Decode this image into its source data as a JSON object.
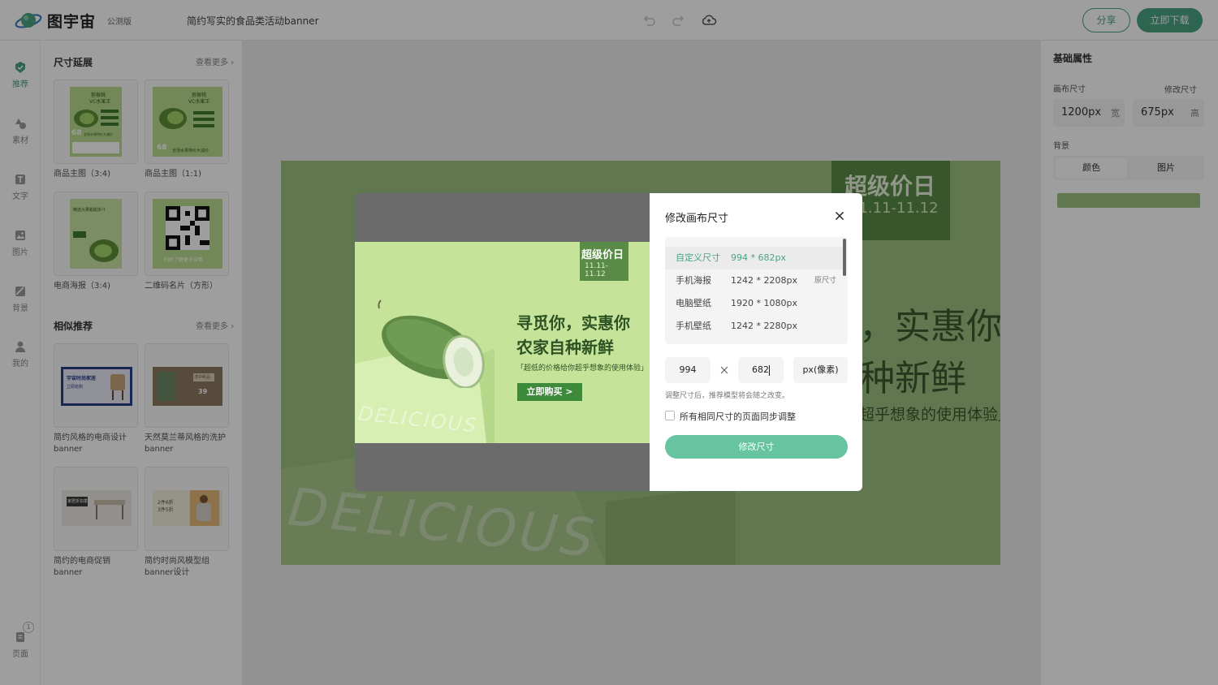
{
  "header": {
    "brand": "图宇宙",
    "beta": "公测版",
    "doc_title": "简约写实的食品类活动banner",
    "share_label": "分享",
    "download_label": "立即下载"
  },
  "rail": {
    "items": [
      {
        "label": "推荐",
        "icon": "recommend-icon"
      },
      {
        "label": "素材",
        "icon": "shapes-icon"
      },
      {
        "label": "文字",
        "icon": "text-icon"
      },
      {
        "label": "图片",
        "icon": "image-icon"
      },
      {
        "label": "背景",
        "icon": "background-icon"
      },
      {
        "label": "我的",
        "icon": "user-icon"
      }
    ],
    "pages_label": "页面",
    "pages_count": "1"
  },
  "left_panel": {
    "size_section": {
      "title": "尺寸延展",
      "more": "查看更多",
      "items": [
        {
          "caption": "商品主图（3:4)"
        },
        {
          "caption": "商品主图（1:1)"
        },
        {
          "caption": "电商海报（3:4)"
        },
        {
          "caption": "二维码名片（方形）"
        }
      ]
    },
    "similar_section": {
      "title": "相似推荐",
      "more": "查看更多",
      "items": [
        {
          "caption": "简约风格的电商设计banner"
        },
        {
          "caption": "天然莫兰蒂风格的洗护banner"
        },
        {
          "caption": "简约的电商促销banner"
        },
        {
          "caption": "简约时尚风模型组banner设计"
        }
      ]
    },
    "thumb_texts": {
      "kiwi_title": "猕猴桃",
      "kiwi_sub": "VC水果王",
      "kiwi_price": "68",
      "kiwi_bottom": "全场水果特价大减价",
      "poster_title": "精选大果甜甜多汁",
      "qr_caption": "扫码了解更多详情",
      "shop_title": "宇宙时尚家居",
      "shop_btn": "立即抢购",
      "wash_price": "39",
      "wash_title": "洗护新品",
      "furniture_title": "家居折扣季",
      "fashion_title": "2件6折",
      "fashion_sub": "3件5折"
    }
  },
  "canvas": {
    "badge_title": "超级价日",
    "badge_date": "11.11-11.12",
    "headline_1": "寻觅你，实惠你",
    "headline_2": "农家自种新鲜",
    "subline": "「超低的价格给你超乎想象的使用体验」",
    "button": "立即购买 >",
    "watermark": "DELICIOUS"
  },
  "right_panel": {
    "title": "基础属性",
    "canvas_size_label": "画布尺寸",
    "edit_size_label": "修改尺寸",
    "width_value": "1200px",
    "width_unit": "宽",
    "height_value": "675px",
    "height_unit": "高",
    "background_label": "背景",
    "tabs": [
      "颜色",
      "图片"
    ],
    "background_color": "#9dc081"
  },
  "modal": {
    "title": "修改画布尺寸",
    "sizes": [
      {
        "name": "自定义尺寸",
        "dims": "994 * 682px",
        "origin": ""
      },
      {
        "name": "手机海报",
        "dims": "1242 * 2208px",
        "origin": "原尺寸"
      },
      {
        "name": "电脑壁纸",
        "dims": "1920 * 1080px",
        "origin": ""
      },
      {
        "name": "手机壁纸",
        "dims": "1242 * 2280px",
        "origin": ""
      }
    ],
    "width_input": "994",
    "height_input": "682",
    "unit": "px(像素)",
    "hint": "调整尺寸后，推荐模型将会随之改变。",
    "sync_label": "所有相同尺寸的页面同步调整",
    "submit": "修改尺寸"
  },
  "colors": {
    "accent": "#4aa382",
    "submit": "#66c4a0",
    "canvas_green": "#9dc081",
    "preview_green": "#c5e49a",
    "badge_green": "#5a8b46",
    "button_green": "#3d8a3a"
  }
}
